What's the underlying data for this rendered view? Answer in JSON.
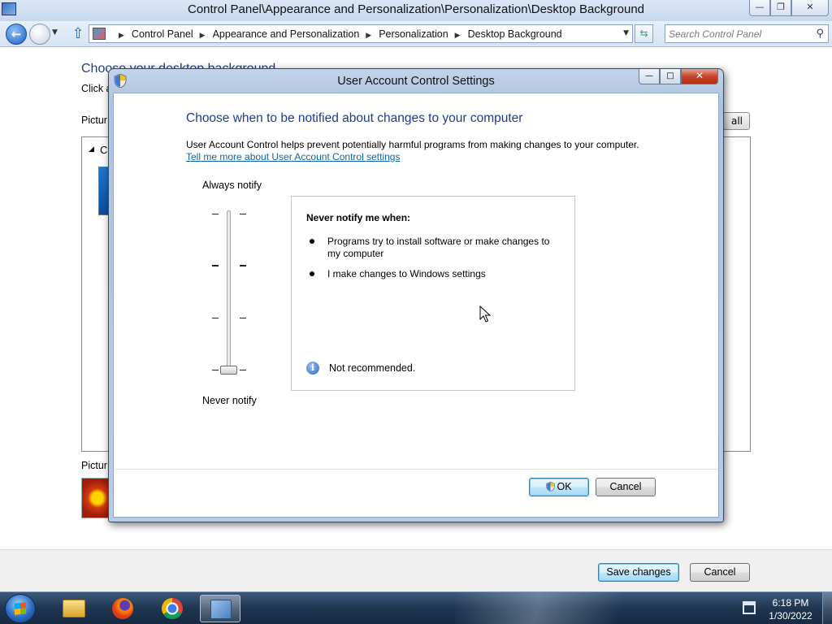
{
  "window": {
    "title": "Control Panel\\Appearance and Personalization\\Personalization\\Desktop Background",
    "minimize": "—",
    "maximize": "❐",
    "close": "✕"
  },
  "address": {
    "crumbs": [
      "Control Panel",
      "Appearance and Personalization",
      "Personalization",
      "Desktop Background"
    ],
    "search_placeholder": "Search Control Panel"
  },
  "background_page": {
    "heading": "Choose your desktop background",
    "subtitle": "Click a",
    "picture_location_label": "Pictur",
    "select_all_label": "all",
    "picture_position_label": "Pictur",
    "group_label": "C"
  },
  "footer": {
    "save_label": "Save changes",
    "cancel_label": "Cancel"
  },
  "uac": {
    "title": "User Account Control Settings",
    "heading": "Choose when to be notified about changes to your computer",
    "description": "User Account Control helps prevent potentially harmful programs from making changes to your computer.",
    "link": "Tell me more about User Account Control settings",
    "top_label": "Always notify",
    "bottom_label": "Never notify",
    "slider_level": 0,
    "slider_levels": 4,
    "info_title": "Never notify me when:",
    "bullets": [
      "Programs try to install software or make changes to my computer",
      "I make changes to Windows settings"
    ],
    "note": "Not recommended.",
    "ok_label": "OK",
    "cancel_label": "Cancel"
  },
  "taskbar": {
    "apps": [
      "folder-icon",
      "firefox-icon",
      "chrome-icon",
      "control-panel-icon"
    ],
    "time": "6:18 PM",
    "date": "1/30/2022"
  },
  "colors": {
    "heading_blue": "#1e3e8a",
    "link_blue": "#0a66a8",
    "taskbar": "#1f3550"
  }
}
